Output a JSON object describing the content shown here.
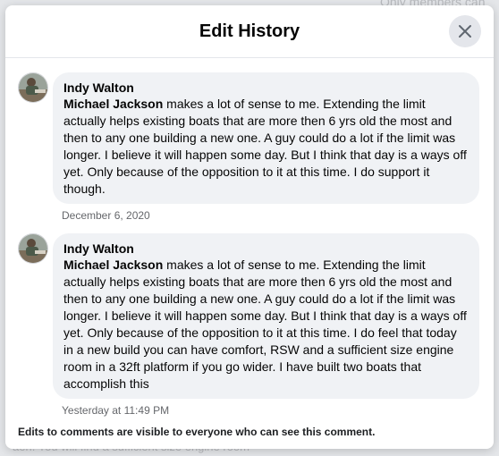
{
  "background": {
    "top_right_text": "Only members can",
    "bottom_left_text": "aeh. You will find a sufficient size engine room"
  },
  "dialog": {
    "title": "Edit History",
    "close_icon": "x-icon",
    "footer_note": "Edits to comments are visible to everyone who can see this comment."
  },
  "entries": [
    {
      "author": "Indy Walton",
      "mention": "Michael Jackson",
      "text": " makes a lot of sense to me. Extending the limit actually helps existing boats that are more then 6 yrs old the most and then to any one building a new one. A guy could do a lot if the limit was longer. I believe it will happen some day. But I think that day is a ways off yet. Only because of the opposition to it at this time. I do support it though.",
      "timestamp": "December 6, 2020"
    },
    {
      "author": "Indy Walton",
      "mention": "Michael Jackson",
      "text": " makes a lot of sense to me. Extending the limit actually helps existing boats that are more then 6 yrs old the most and then to any one building a new one. A guy could do a lot if the limit was longer. I believe it will happen some day. But I think that day is a ways off yet. Only because of the opposition to it at this time. I do feel that today in a new build you can have comfort, RSW and a sufficient size engine room in a 32ft platform if you go wider. I have built two boats that accomplish this",
      "timestamp": "Yesterday at 11:49 PM"
    }
  ]
}
